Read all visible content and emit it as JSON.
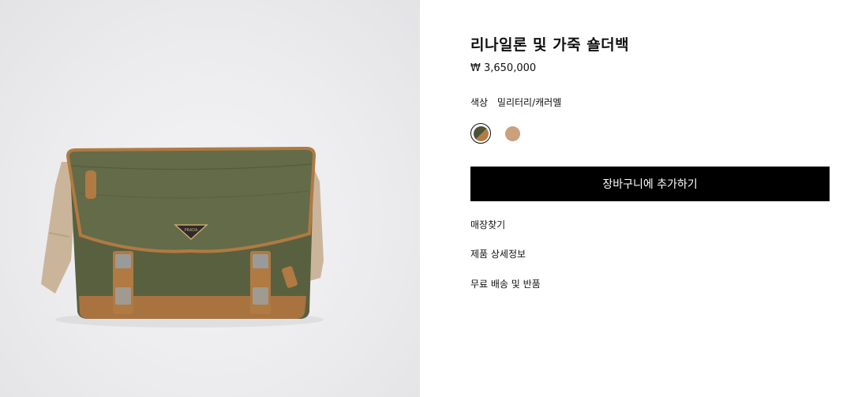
{
  "product": {
    "title": "리나일론 및 가죽 숄더백",
    "price": "₩ 3,650,000",
    "image_subject": "messenger-bag",
    "colors": {
      "label": "색상",
      "selected_value": "밀리터리/캐러멜",
      "swatches": [
        {
          "name": "military-caramel",
          "hex_primary": "#4d5236",
          "hex_secondary": "#b27c45",
          "selected": true
        },
        {
          "name": "camel",
          "hex_primary": "#caa07d",
          "selected": false
        }
      ]
    }
  },
  "actions": {
    "add_to_cart": "장바구니에 추가하기"
  },
  "links": {
    "find_store": "매장찾기",
    "product_details": "제품 상세정보",
    "shipping_returns": "무료 배송 및 반품"
  },
  "theme": {
    "button_bg": "#000000",
    "bag_nylon": "#5b6240",
    "bag_leather": "#b07a42",
    "strap": "#cbb59a"
  }
}
